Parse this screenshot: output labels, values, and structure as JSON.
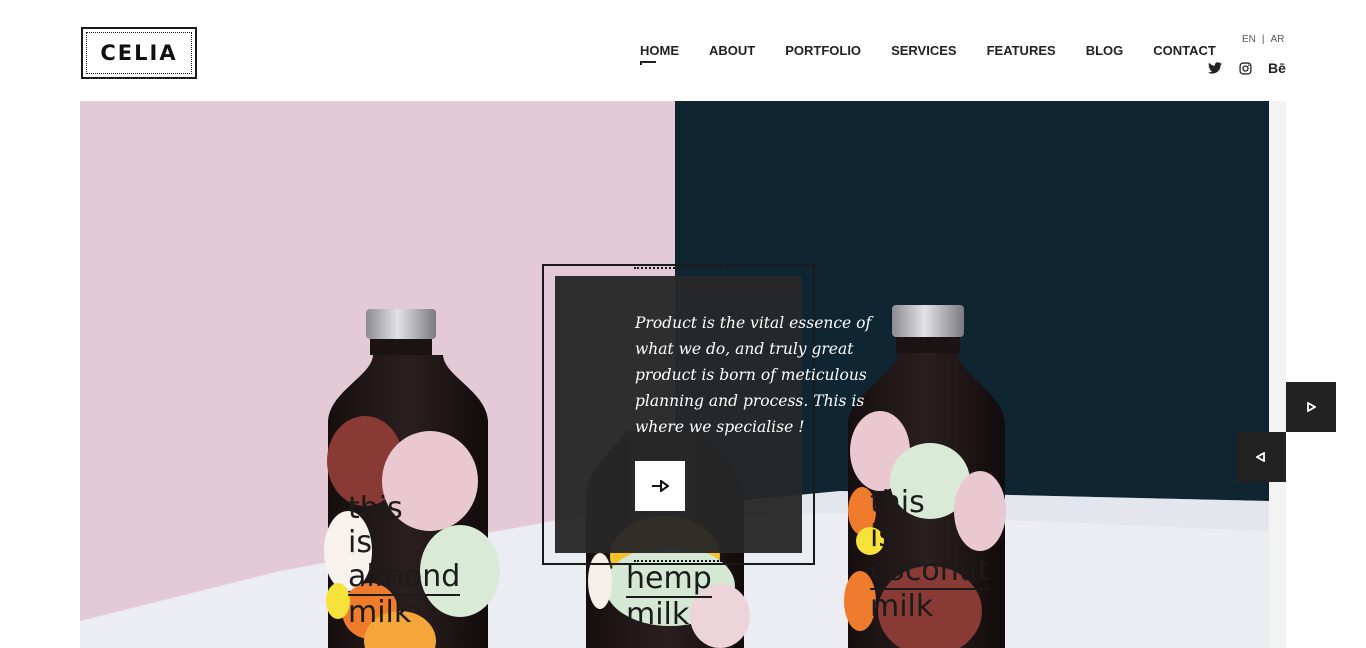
{
  "brand": {
    "logo_text": "CELIA"
  },
  "nav": {
    "items": [
      {
        "label": "HOME",
        "active": true
      },
      {
        "label": "ABOUT",
        "active": false
      },
      {
        "label": "PORTFOLIO",
        "active": false
      },
      {
        "label": "SERVICES",
        "active": false
      },
      {
        "label": "FEATURES",
        "active": false
      },
      {
        "label": "BLOG",
        "active": false
      },
      {
        "label": "CONTACT",
        "active": false
      }
    ]
  },
  "language": {
    "en": "EN",
    "separator": "|",
    "ar": "AR"
  },
  "social": {
    "twitter_icon": "twitter-icon",
    "instagram_icon": "instagram-icon",
    "behance_label": "Bē"
  },
  "hero": {
    "colors": {
      "pink": "#e4cad7",
      "navy": "#0f2532",
      "table": "#ebedf2",
      "bottle": "#1c1414"
    },
    "bottles": [
      {
        "line1": "this",
        "line2": "is",
        "line3": "almond",
        "line4": "milk"
      },
      {
        "line3": "hemp",
        "line4": "milk"
      },
      {
        "line1": "this",
        "line2": "is",
        "line3": "coconut",
        "line4": "milk"
      }
    ]
  },
  "quote": {
    "text": "Product is the vital essence of what we do, and truly great product is born of meticulous planning and process. This is where we specialise !",
    "button_icon": "arrow-right-icon"
  },
  "slider": {
    "next_icon": "triangle-right-icon",
    "prev_icon": "triangle-left-icon"
  }
}
